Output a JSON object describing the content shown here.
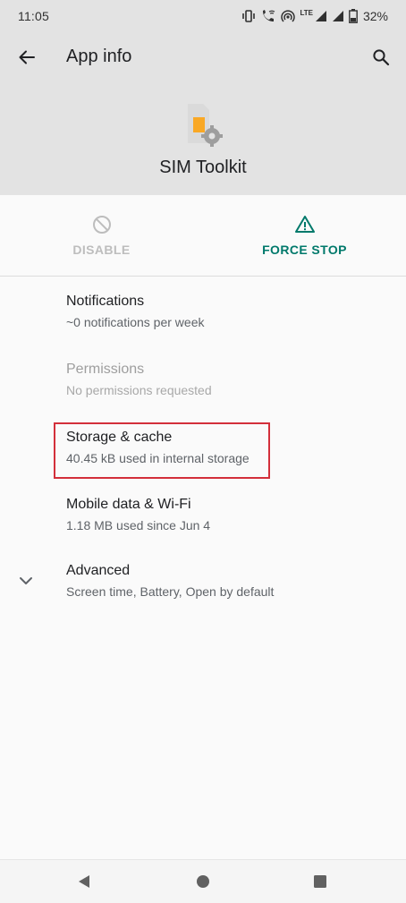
{
  "status_bar": {
    "time": "11:05",
    "lte_label": "LTE",
    "battery_percent": "32%",
    "icons": [
      "vibrate-icon",
      "wifi-calling-icon",
      "hotspot-icon",
      "lte-signal-icon",
      "signal-icon",
      "battery-icon"
    ]
  },
  "app_bar": {
    "title": "App info",
    "back_icon": "arrow-back-icon",
    "search_icon": "search-icon"
  },
  "app": {
    "name": "SIM Toolkit",
    "icon": "sim-card-gear-icon"
  },
  "actions": {
    "disable": {
      "label": "DISABLE",
      "icon": "block-icon",
      "enabled": false
    },
    "force_stop": {
      "label": "FORCE STOP",
      "icon": "warning-triangle-icon",
      "enabled": true
    }
  },
  "settings": {
    "notifications": {
      "title": "Notifications",
      "subtitle": "~0 notifications per week"
    },
    "permissions": {
      "title": "Permissions",
      "subtitle": "No permissions requested",
      "enabled": false
    },
    "storage": {
      "title": "Storage & cache",
      "subtitle": "40.45 kB used in internal storage",
      "highlighted": true
    },
    "mobile_data": {
      "title": "Mobile data & Wi-Fi",
      "subtitle": "1.18 MB used since Jun 4"
    },
    "advanced": {
      "title": "Advanced",
      "subtitle": "Screen time, Battery, Open by default",
      "icon": "chevron-down-icon"
    }
  },
  "nav_bar": {
    "icons": [
      "nav-back-icon",
      "nav-home-icon",
      "nav-recents-icon"
    ]
  },
  "colors": {
    "header_bg": "#e3e3e3",
    "accent": "#00796b",
    "highlight_border": "#d32f3a",
    "disabled_text": "#bdbdbd",
    "sim_orange": "#f9a825"
  }
}
